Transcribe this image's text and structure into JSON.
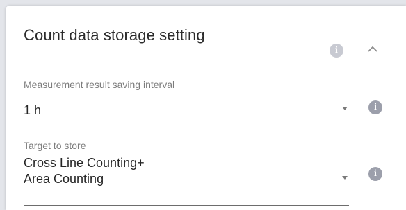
{
  "panel": {
    "title": "Count data storage setting",
    "info_icon": "info-icon",
    "collapse_icon": "chevron-up-icon"
  },
  "fields": [
    {
      "label": "Measurement result saving interval",
      "value": "1 h",
      "icon": "chevron-down-icon",
      "info_icon": "info-icon"
    },
    {
      "label": "Target to store",
      "value_line1": "Cross Line Counting+",
      "value_line2": "Area Counting",
      "icon": "chevron-down-icon",
      "info_icon": "info-icon"
    }
  ],
  "colors": {
    "background": "#e3e5ea",
    "card": "#ffffff",
    "info_icon": "#9c9fab",
    "info_icon_light": "#c8cad2",
    "text": "#262626",
    "label": "#7c7c7c"
  }
}
